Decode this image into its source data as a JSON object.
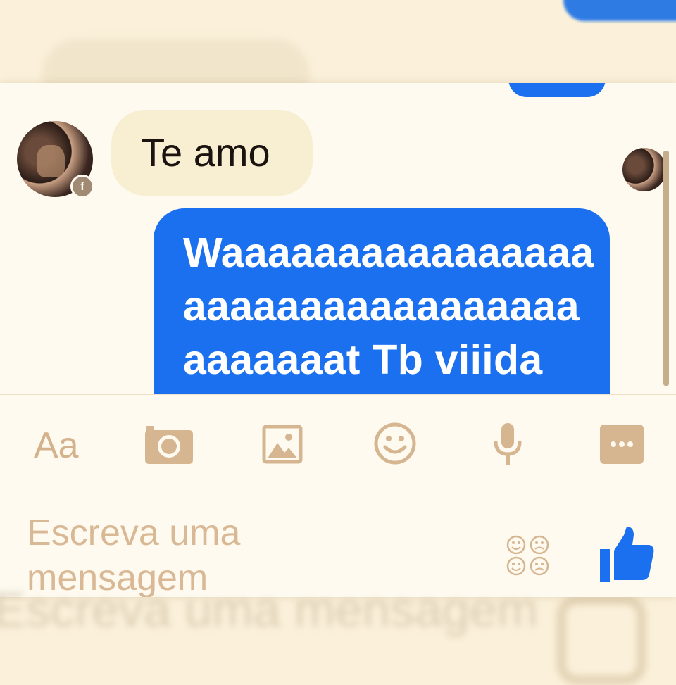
{
  "thread": {
    "received_message": "Te amo",
    "sent_message_lines": [
      "Waaaaaaaaaaaaaaaa",
      "aaaaaaaaaaaaaaaaa",
      "aaaaaaat Tb viiida"
    ],
    "avatar_badge": "f"
  },
  "toolbar": {
    "text_tool_label": "Aa",
    "icons": [
      "text-icon",
      "camera-icon",
      "gallery-icon",
      "emoji-icon",
      "microphone-icon",
      "more-icon"
    ]
  },
  "composer": {
    "placeholder": "Escreva uma mensagem"
  },
  "colors": {
    "sent_bubble": "#1a70ef",
    "received_bubble": "#f8eed2",
    "icon_tint": "#d6b690",
    "like": "#1a70ef"
  }
}
